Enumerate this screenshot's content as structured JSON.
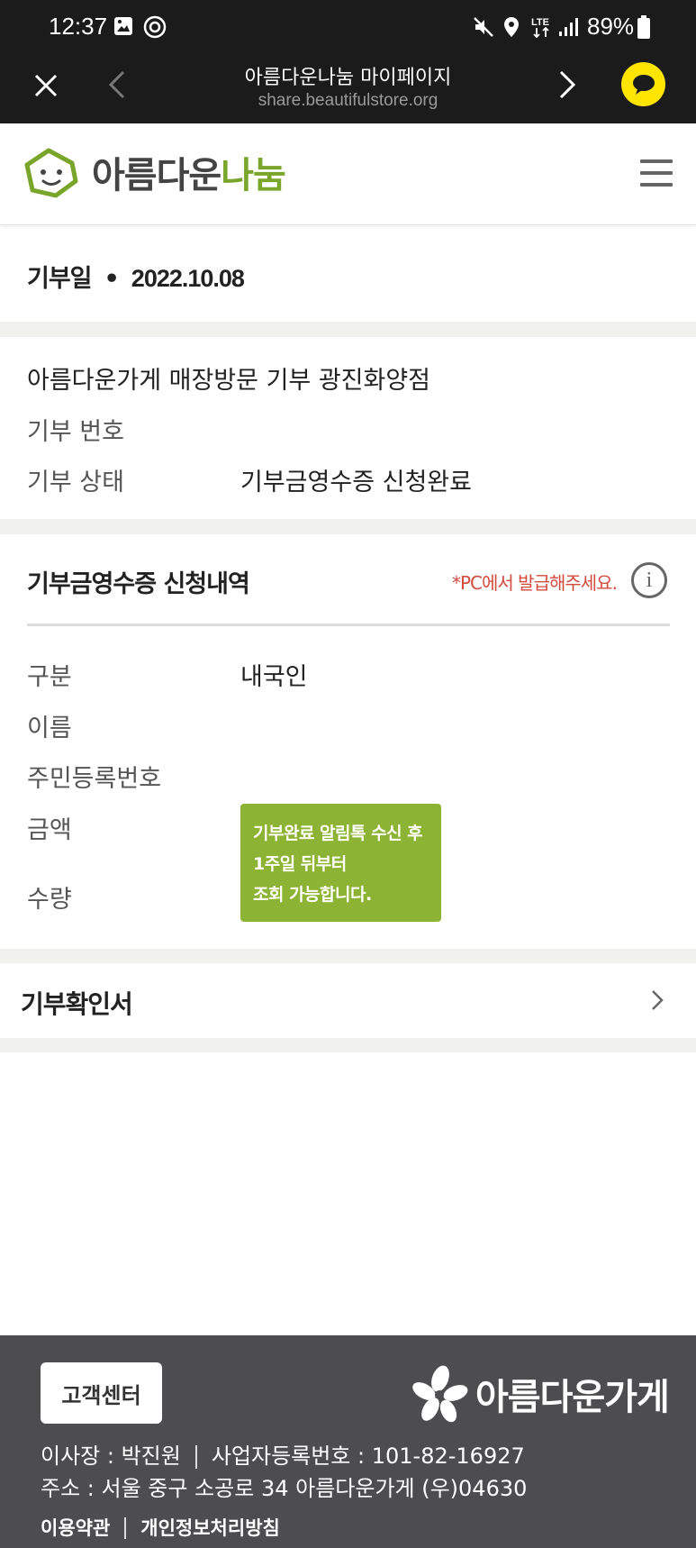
{
  "status_bar": {
    "time": "12:37",
    "battery": "89%",
    "left_icons": [
      "gallery-icon",
      "at-sign-icon"
    ],
    "right_icons": [
      "mute-icon",
      "location-icon",
      "lte-icon",
      "signal-icon",
      "battery-icon"
    ]
  },
  "browser": {
    "title": "아름다운나눔 마이페이지",
    "url": "share.beautifulstore.org"
  },
  "header": {
    "logo_part1": "아름다운",
    "logo_part2": "나눔"
  },
  "donation": {
    "date_label": "기부일",
    "date_value": "2022.10.08",
    "store_visit": "아름다운가게 매장방문 기부   광진화양점",
    "number_label": "기부 번호",
    "number_value": "",
    "status_label": "기부 상태",
    "status_value": "기부금영수증 신청완료"
  },
  "receipt": {
    "title": "기부금영수증 신청내역",
    "notice": "*PC에서 발급해주세요.",
    "type_label": "구분",
    "type_value": "내국인",
    "name_label": "이름",
    "id_label": "주민등록번호",
    "amount_label": "금액",
    "qty_label": "수량",
    "notice_box": [
      "기부완료 알림톡 수신 후",
      "1주일 뒤부터",
      "조회 가능합니다."
    ]
  },
  "confirmation": {
    "label": "기부확인서"
  },
  "footer": {
    "cs_button": "고객센터",
    "logo_text": "아름다운가게",
    "ceo": "이사장 : 박진원",
    "biz_no": "사업자등록번호 : 101-82-16927",
    "address": "주소 : 서울 중구 소공로 34 아름다운가게 (우)04630",
    "terms": "이용약관",
    "privacy": "개인정보처리방침"
  },
  "colors": {
    "brand_green": "#7aa52b",
    "notice_green": "#8cb333",
    "notice_red": "#d24b3e",
    "footer_bg": "#4d4d4f",
    "kakao_yellow": "#fee500"
  }
}
